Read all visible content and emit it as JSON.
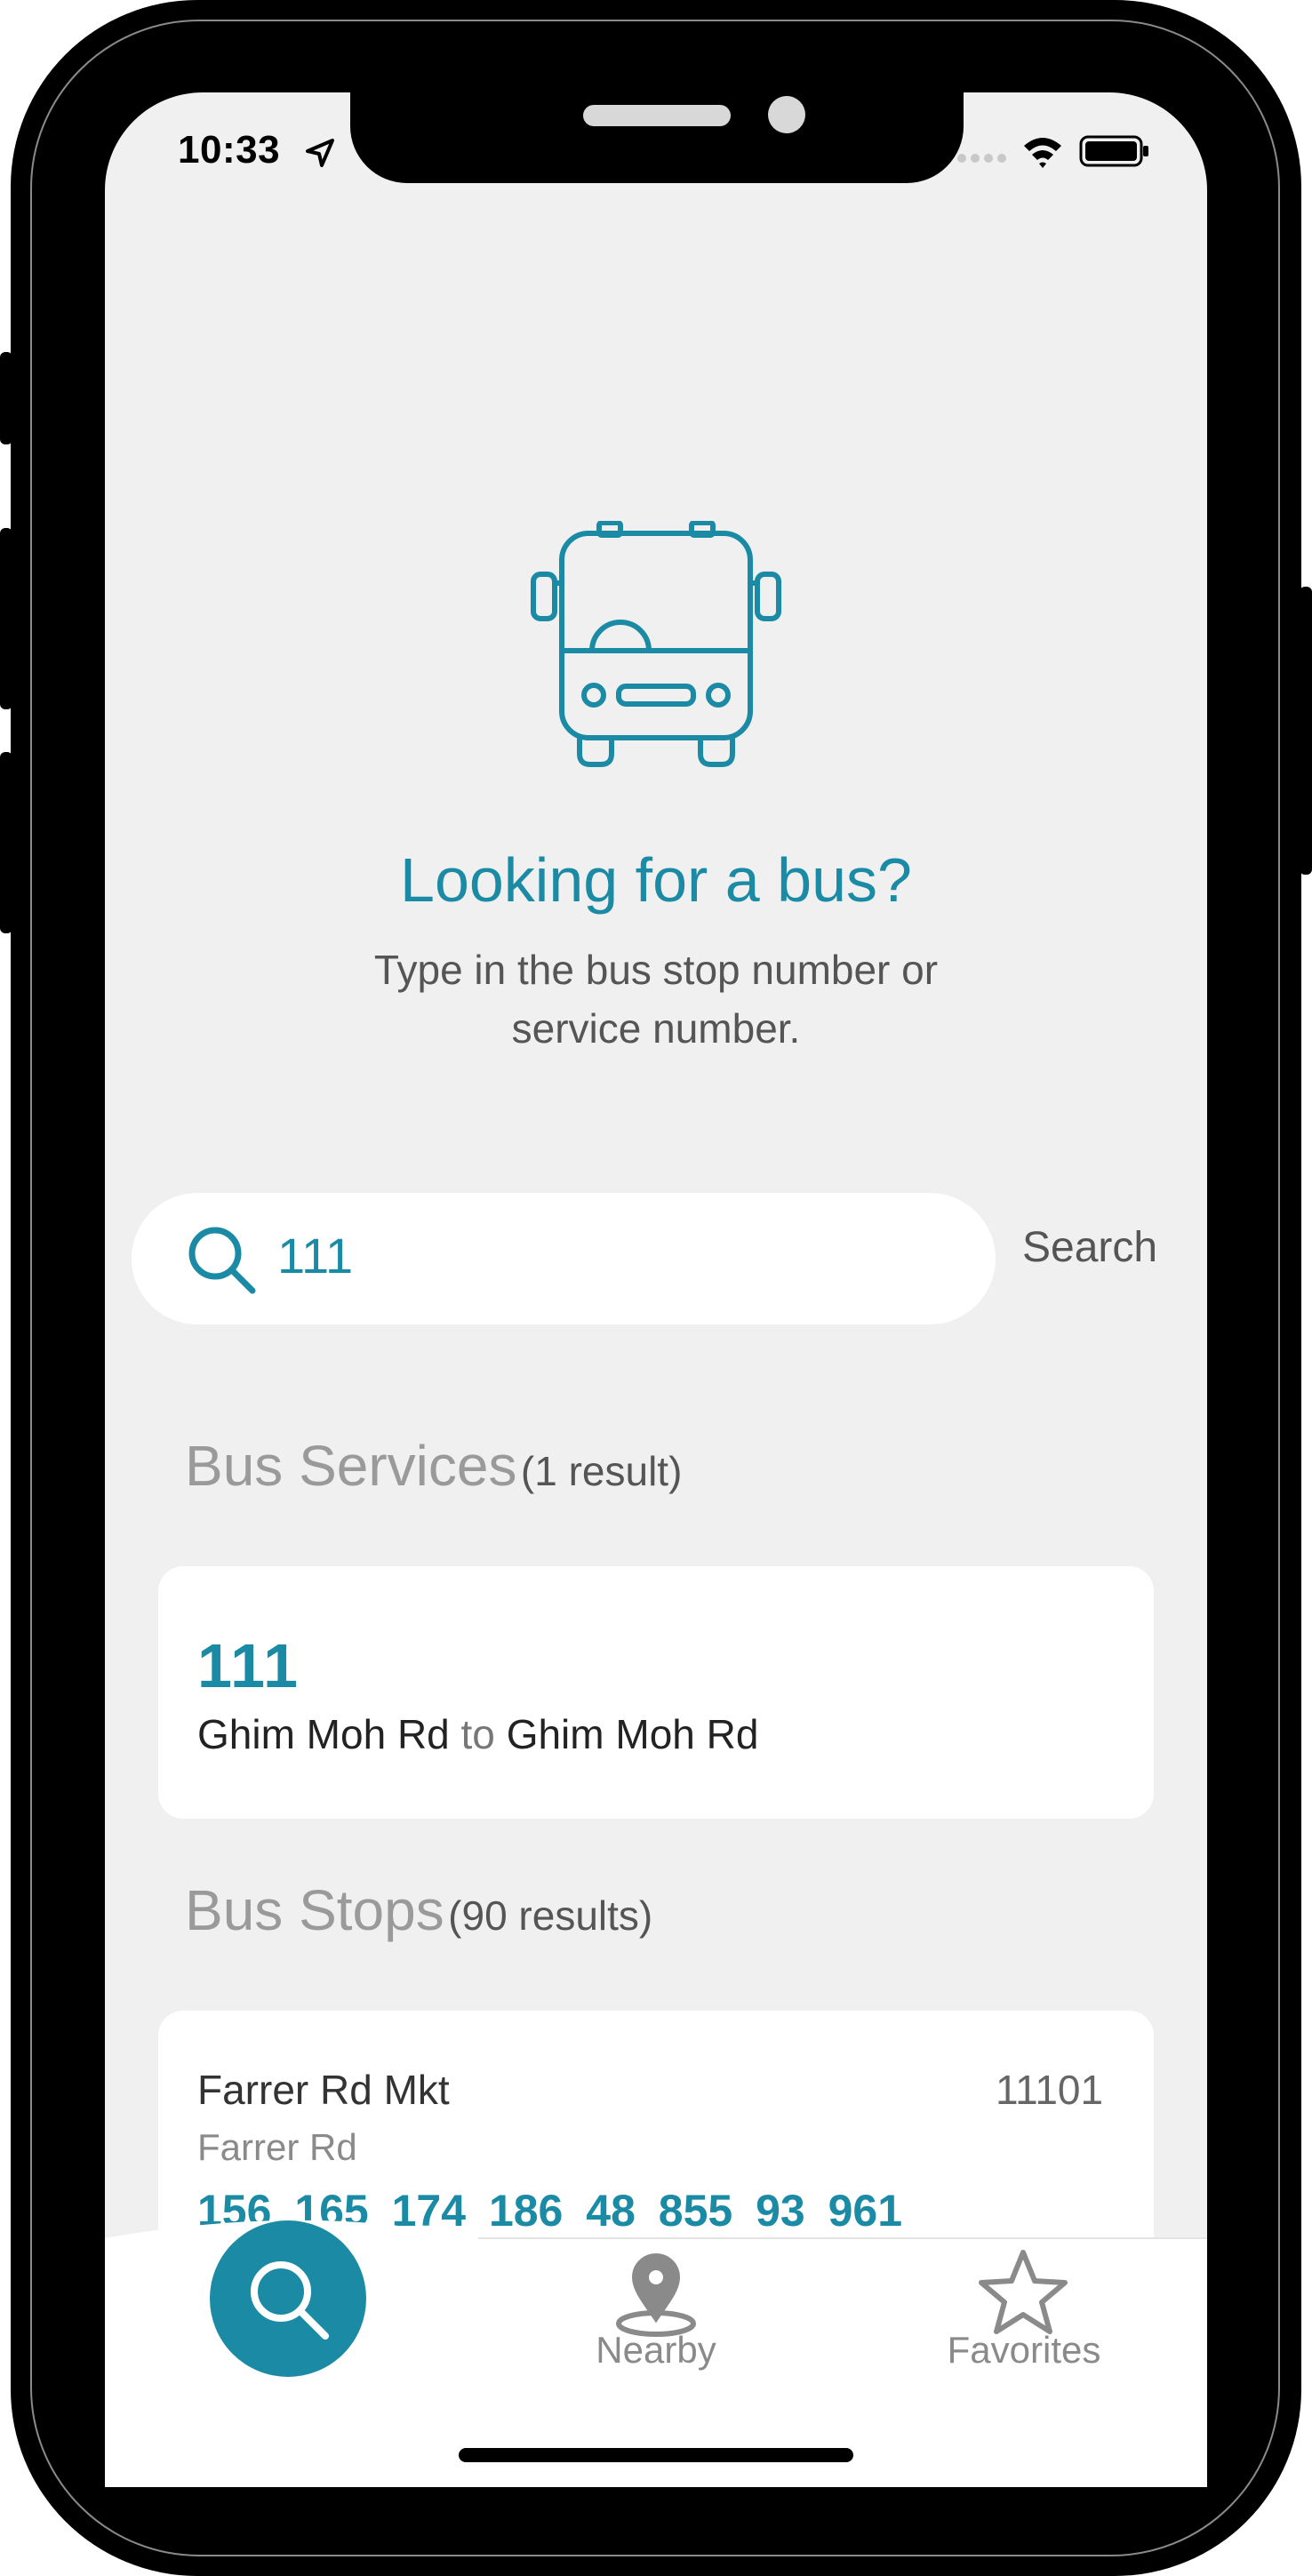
{
  "status_bar": {
    "time": "10:33"
  },
  "hero": {
    "title": "Looking for a bus?",
    "subtitle_line1": "Type in the bus stop number or",
    "subtitle_line2": "service number."
  },
  "search": {
    "value": "111",
    "button_label": "Search"
  },
  "bus_services": {
    "heading": "Bus Services",
    "count": "(1 result)",
    "items": [
      {
        "number": "111",
        "from": "Ghim Moh Rd",
        "to_word": "to",
        "to": "Ghim Moh Rd"
      }
    ]
  },
  "bus_stops": {
    "heading": "Bus Stops",
    "count": "(90 results)",
    "items": [
      {
        "name": "Farrer Rd Mkt",
        "code": "11101",
        "road": "Farrer Rd",
        "services": "156 165 174 186 48 855 93 961"
      }
    ]
  },
  "tab_bar": {
    "tabs": [
      {
        "label": "Search",
        "icon": "search-icon",
        "active": true
      },
      {
        "label": "Nearby",
        "icon": "location-pin-icon",
        "active": false
      },
      {
        "label": "Favorites",
        "icon": "star-icon",
        "active": false
      }
    ]
  },
  "colors": {
    "accent": "#1b8aa5",
    "background": "#f0f0f0",
    "card": "#ffffff",
    "muted_text": "#9a9a9a"
  }
}
